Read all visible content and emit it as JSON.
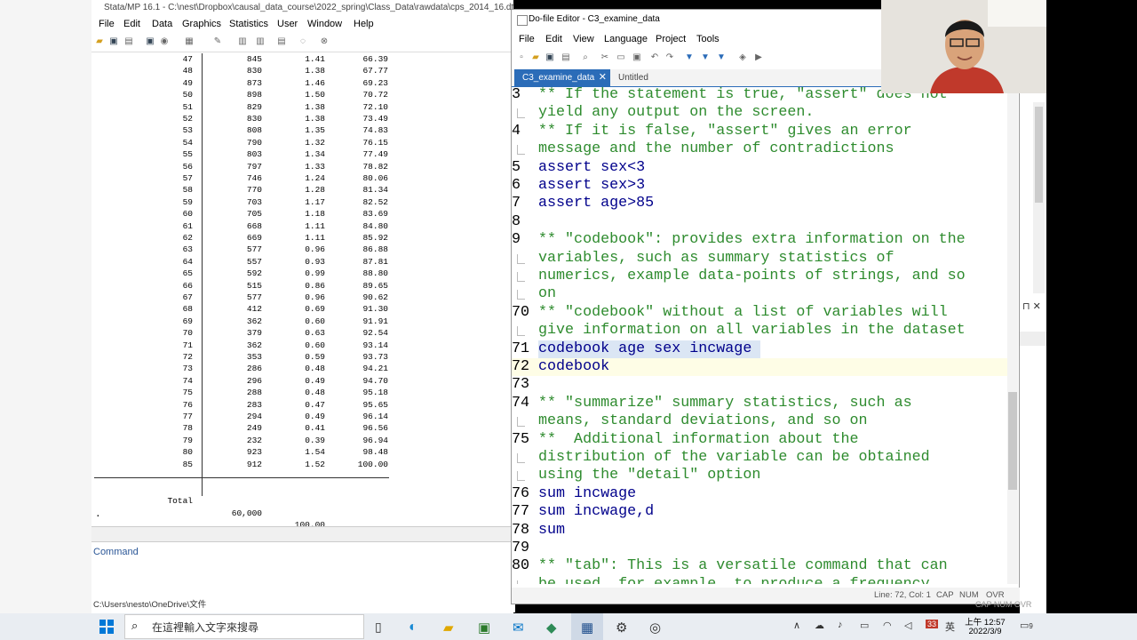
{
  "stata": {
    "title": "Stata/MP 16.1 - C:\\nest\\Dropbox\\causal_data_course\\2022_spring\\Class_Data\\rawdata\\cps_2014_16.dta",
    "menu": [
      "File",
      "Edit",
      "Data",
      "Graphics",
      "Statistics",
      "User",
      "Window",
      "Help"
    ],
    "results_rows": [
      {
        "age": "47",
        "freq": "845",
        "percent": "1.41",
        "cum": "66.39"
      },
      {
        "age": "48",
        "freq": "830",
        "percent": "1.38",
        "cum": "67.77"
      },
      {
        "age": "49",
        "freq": "873",
        "percent": "1.46",
        "cum": "69.23"
      },
      {
        "age": "50",
        "freq": "898",
        "percent": "1.50",
        "cum": "70.72"
      },
      {
        "age": "51",
        "freq": "829",
        "percent": "1.38",
        "cum": "72.10"
      },
      {
        "age": "52",
        "freq": "830",
        "percent": "1.38",
        "cum": "73.49"
      },
      {
        "age": "53",
        "freq": "808",
        "percent": "1.35",
        "cum": "74.83"
      },
      {
        "age": "54",
        "freq": "790",
        "percent": "1.32",
        "cum": "76.15"
      },
      {
        "age": "55",
        "freq": "803",
        "percent": "1.34",
        "cum": "77.49"
      },
      {
        "age": "56",
        "freq": "797",
        "percent": "1.33",
        "cum": "78.82"
      },
      {
        "age": "57",
        "freq": "746",
        "percent": "1.24",
        "cum": "80.06"
      },
      {
        "age": "58",
        "freq": "770",
        "percent": "1.28",
        "cum": "81.34"
      },
      {
        "age": "59",
        "freq": "703",
        "percent": "1.17",
        "cum": "82.52"
      },
      {
        "age": "60",
        "freq": "705",
        "percent": "1.18",
        "cum": "83.69"
      },
      {
        "age": "61",
        "freq": "668",
        "percent": "1.11",
        "cum": "84.80"
      },
      {
        "age": "62",
        "freq": "669",
        "percent": "1.11",
        "cum": "85.92"
      },
      {
        "age": "63",
        "freq": "577",
        "percent": "0.96",
        "cum": "86.88"
      },
      {
        "age": "64",
        "freq": "557",
        "percent": "0.93",
        "cum": "87.81"
      },
      {
        "age": "65",
        "freq": "592",
        "percent": "0.99",
        "cum": "88.80"
      },
      {
        "age": "66",
        "freq": "515",
        "percent": "0.86",
        "cum": "89.65"
      },
      {
        "age": "67",
        "freq": "577",
        "percent": "0.96",
        "cum": "90.62"
      },
      {
        "age": "68",
        "freq": "412",
        "percent": "0.69",
        "cum": "91.30"
      },
      {
        "age": "69",
        "freq": "362",
        "percent": "0.60",
        "cum": "91.91"
      },
      {
        "age": "70",
        "freq": "379",
        "percent": "0.63",
        "cum": "92.54"
      },
      {
        "age": "71",
        "freq": "362",
        "percent": "0.60",
        "cum": "93.14"
      },
      {
        "age": "72",
        "freq": "353",
        "percent": "0.59",
        "cum": "93.73"
      },
      {
        "age": "73",
        "freq": "286",
        "percent": "0.48",
        "cum": "94.21"
      },
      {
        "age": "74",
        "freq": "296",
        "percent": "0.49",
        "cum": "94.70"
      },
      {
        "age": "75",
        "freq": "288",
        "percent": "0.48",
        "cum": "95.18"
      },
      {
        "age": "76",
        "freq": "283",
        "percent": "0.47",
        "cum": "95.65"
      },
      {
        "age": "77",
        "freq": "294",
        "percent": "0.49",
        "cum": "96.14"
      },
      {
        "age": "78",
        "freq": "249",
        "percent": "0.41",
        "cum": "96.56"
      },
      {
        "age": "79",
        "freq": "232",
        "percent": "0.39",
        "cum": "96.94"
      },
      {
        "age": "80",
        "freq": "923",
        "percent": "1.54",
        "cum": "98.48"
      },
      {
        "age": "85",
        "freq": "912",
        "percent": "1.52",
        "cum": "100.00"
      }
    ],
    "total": {
      "label": "Total",
      "freq": "60,000",
      "percent": "100.00"
    },
    "prompt_dot": ".",
    "command_label": "Command",
    "cwd": "C:\\Users\\nesto\\OneDrive\\文件"
  },
  "editor": {
    "title": "Do-file Editor - C3_examine_data",
    "menu": [
      "File",
      "Edit",
      "View",
      "Language",
      "Project",
      "Tools"
    ],
    "tab_active": "C3_examine_data",
    "tab_close": "✕",
    "tab_other": "Untitled",
    "lines": [
      {
        "ln": "3",
        "text": "** If the statement is true, \"assert\" does not",
        "kind": "comment"
      },
      {
        "ln": "",
        "text": "yield any output on the screen.",
        "kind": "comment",
        "wrap": true
      },
      {
        "ln": "4",
        "text": "** If it is false, \"assert\" gives an error",
        "kind": "comment"
      },
      {
        "ln": "",
        "text": "message and the number of contradictions",
        "kind": "comment",
        "wrap": true
      },
      {
        "ln": "5",
        "text": "assert sex<3",
        "kind": "code"
      },
      {
        "ln": "6",
        "text": "assert sex>3",
        "kind": "code"
      },
      {
        "ln": "7",
        "text": "assert age>85",
        "kind": "code"
      },
      {
        "ln": "8",
        "text": "",
        "kind": "code"
      },
      {
        "ln": "9",
        "text": "** \"codebook\": provides extra information on the",
        "kind": "comment"
      },
      {
        "ln": "",
        "text": "variables, such as summary statistics of",
        "kind": "comment",
        "wrap": true
      },
      {
        "ln": "",
        "text": "numerics, example data-points of strings, and so",
        "kind": "comment",
        "wrap": true
      },
      {
        "ln": "",
        "text": "on",
        "kind": "comment",
        "wrap": true
      },
      {
        "ln": "70",
        "text": "** \"codebook\" without a list of variables will",
        "kind": "comment"
      },
      {
        "ln": "",
        "text": "give information on all variables in the dataset",
        "kind": "comment",
        "wrap": true
      },
      {
        "ln": "71",
        "text": "codebook age sex incwage ",
        "kind": "selected"
      },
      {
        "ln": "72",
        "text": "codebook",
        "kind": "current"
      },
      {
        "ln": "73",
        "text": "",
        "kind": "code"
      },
      {
        "ln": "74",
        "text": "** \"summarize\" summary statistics, such as",
        "kind": "comment"
      },
      {
        "ln": "",
        "text": "means, standard deviations, and so on",
        "kind": "comment",
        "wrap": true
      },
      {
        "ln": "75",
        "text": "**  Additional information about the",
        "kind": "comment"
      },
      {
        "ln": "",
        "text": "distribution of the variable can be obtained",
        "kind": "comment",
        "wrap": true
      },
      {
        "ln": "",
        "text": "using the \"detail\" option",
        "kind": "comment",
        "wrap": true
      },
      {
        "ln": "76",
        "text": "sum incwage",
        "kind": "code"
      },
      {
        "ln": "77",
        "text": "sum incwage,d",
        "kind": "code"
      },
      {
        "ln": "78",
        "text": "sum",
        "kind": "code"
      },
      {
        "ln": "79",
        "text": "",
        "kind": "code"
      },
      {
        "ln": "80",
        "text": "** \"tab\": This is a versatile command that can",
        "kind": "comment"
      },
      {
        "ln": "",
        "text": "be used, for example, to produce a frequency",
        "kind": "comment",
        "wrap": true
      }
    ],
    "status": {
      "position": "Line: 72, Col: 1",
      "cap": "CAP",
      "num": "NUM",
      "ovr": "OVR"
    }
  },
  "right_status": "CAP  NUM  OVR",
  "taskbar": {
    "search_placeholder": "在這裡輸入文字來搜尋",
    "ime": "英",
    "time": "上午 12:57",
    "date": "2022/3/9",
    "notif_count": "9",
    "badge": "33"
  },
  "colors": {
    "comment": "#2e8b2e",
    "tab_active": "#2b6cb8",
    "selection": "#dbe6f4",
    "current_line": "#fefde6"
  }
}
